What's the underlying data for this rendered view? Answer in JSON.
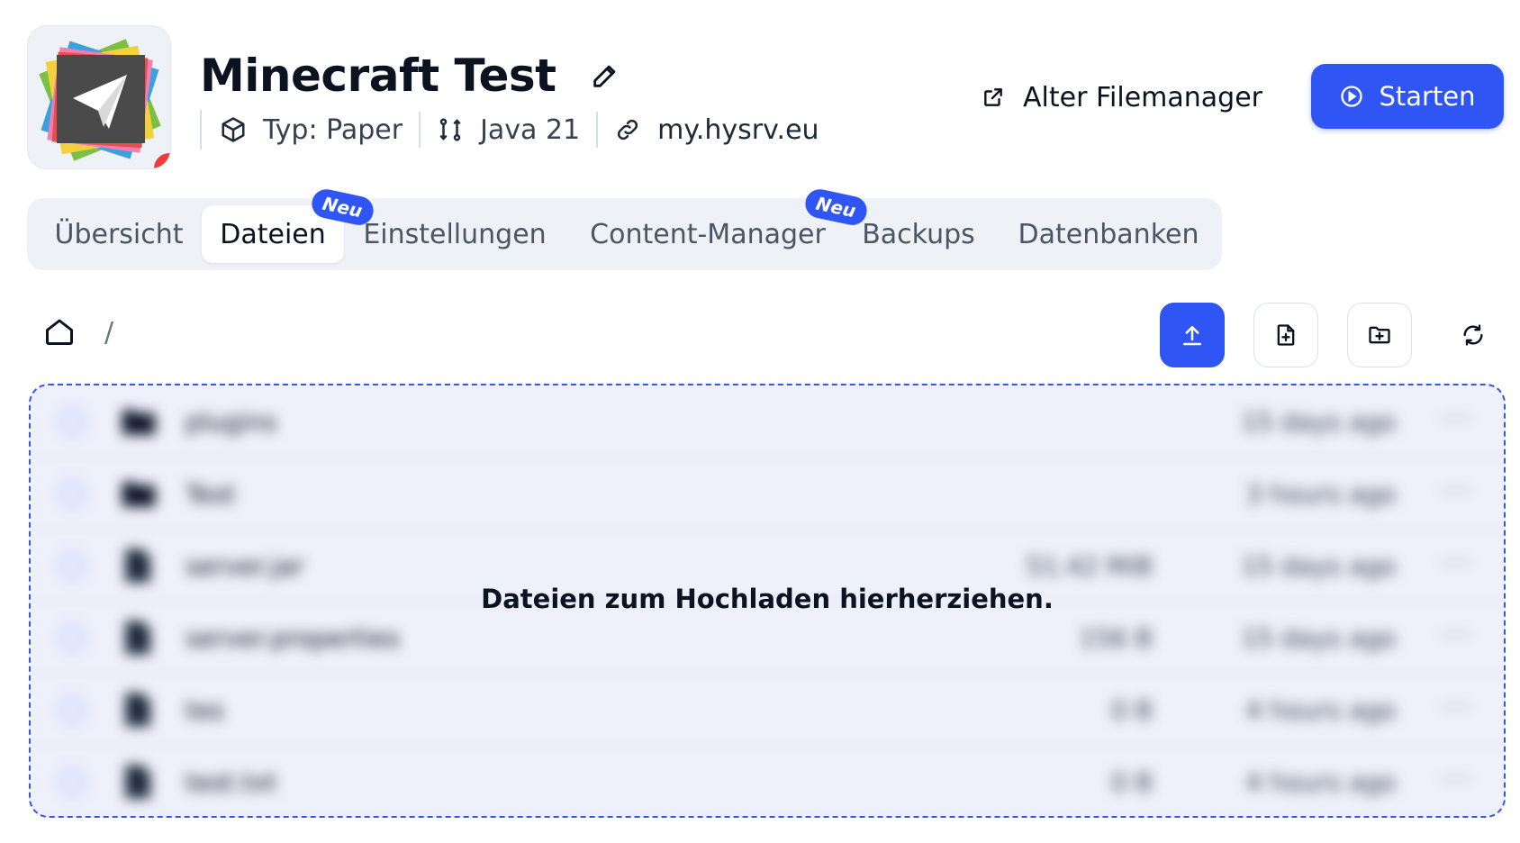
{
  "server": {
    "name": "Minecraft Test",
    "type": "Typ: Paper",
    "java": "Java 21",
    "address": "my.hysrv.eu",
    "status_color": "#ef3b3b"
  },
  "header": {
    "old_filemanager": "Alter Filemanager",
    "start_label": "Starten"
  },
  "tabs": [
    {
      "label": "Übersicht",
      "active": false
    },
    {
      "label": "Dateien",
      "active": true,
      "badge": "Neu"
    },
    {
      "label": "Einstellungen",
      "active": false
    },
    {
      "label": "Content-Manager",
      "active": false,
      "badge": "Neu"
    },
    {
      "label": "Backups",
      "active": false
    },
    {
      "label": "Datenbanken",
      "active": false
    }
  ],
  "breadcrumb": {
    "separator": "/"
  },
  "toolbar": {
    "icons": [
      "upload-icon",
      "new-file-icon",
      "new-folder-icon",
      "refresh-icon"
    ]
  },
  "files": [
    {
      "name": "plugins",
      "type": "folder",
      "size": "",
      "modified": "15 days ago"
    },
    {
      "name": "Test",
      "type": "folder",
      "size": "",
      "modified": "3 hours ago"
    },
    {
      "name": "server.jar",
      "type": "file",
      "size": "51.42 MiB",
      "modified": "15 days ago"
    },
    {
      "name": "server.properties",
      "type": "file",
      "size": "156 B",
      "modified": "15 days ago"
    },
    {
      "name": "tes",
      "type": "file",
      "size": "0 B",
      "modified": "4 hours ago"
    },
    {
      "name": "test.txt",
      "type": "file",
      "size": "0 B",
      "modified": "4 hours ago"
    }
  ],
  "dropzone": {
    "message": "Dateien zum Hochladen hierherziehen."
  },
  "colors": {
    "accent": "#2f55f4",
    "dropzone_border": "#3556e8",
    "dropzone_bg": "#eef0fb"
  }
}
